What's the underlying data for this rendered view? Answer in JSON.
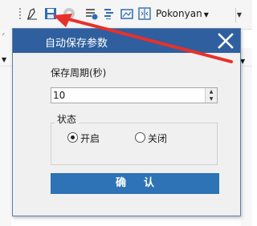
{
  "toolbar": {
    "layer_combo_value": "Pokonyan",
    "icons": [
      "pen-icon",
      "save-icon",
      "gear-disabled-icon",
      "import-icon",
      "list-icon",
      "photo-icon",
      "split-icon"
    ]
  },
  "dialog": {
    "title": "自动保存参数",
    "period_label": "保存周期(秒)",
    "period_value": "10",
    "status_group_label": "状态",
    "radio_on_label": "开启",
    "radio_off_label": "关闭",
    "radio_selected": "on",
    "confirm_char1": "确",
    "confirm_char2": "认"
  },
  "colors": {
    "titlebar": "#2f5f9e",
    "confirm_button": "#2d73b5",
    "annotation_arrow": "#e8302a"
  }
}
